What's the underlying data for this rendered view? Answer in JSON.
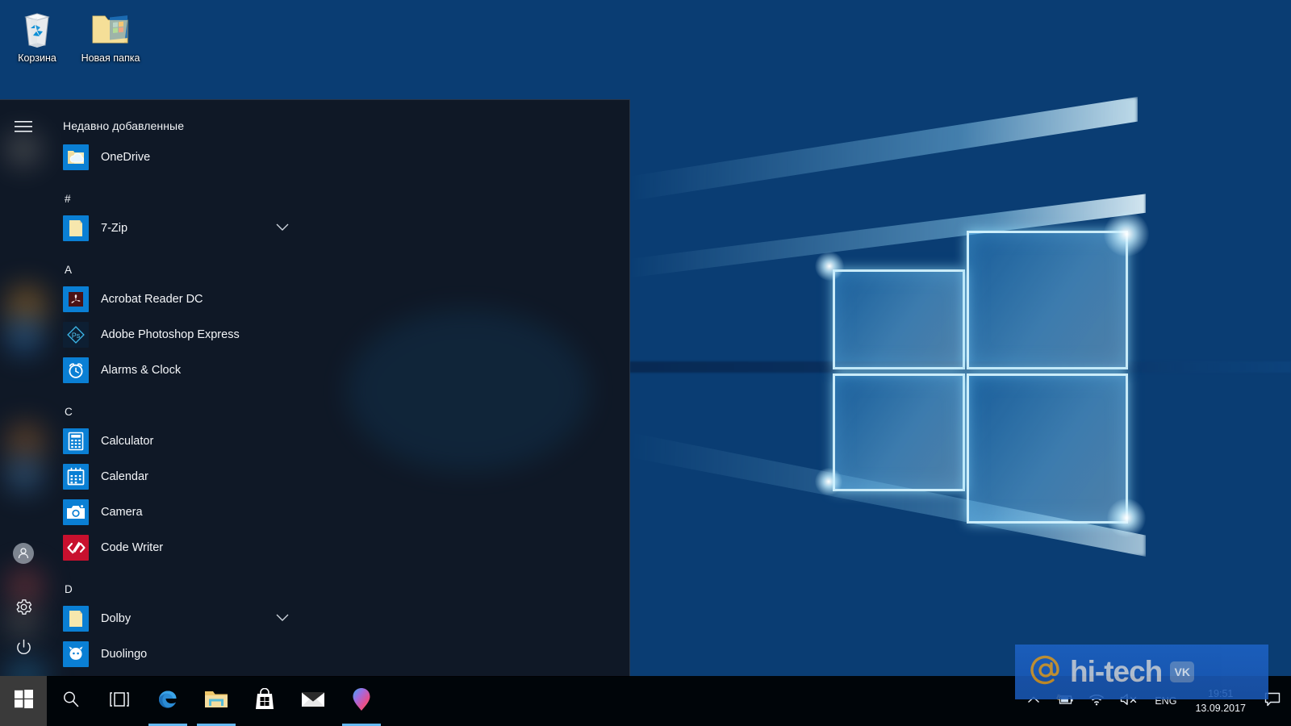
{
  "desktop": {
    "icons": [
      {
        "label": "Корзина",
        "icon": "recycle-bin-icon"
      },
      {
        "label": "Новая папка",
        "icon": "folder-icon"
      }
    ]
  },
  "start_menu": {
    "rail": {
      "hamburger": "hamburger-icon",
      "user": "user-account-icon",
      "settings": "gear-icon",
      "power": "power-icon"
    },
    "recent_header": "Недавно добавленные",
    "recent_apps": [
      {
        "label": "OneDrive",
        "icon": "onedrive-icon",
        "tile": "#0a7fd4",
        "expandable": false
      }
    ],
    "groups": [
      {
        "letter": "#",
        "apps": [
          {
            "label": "7-Zip",
            "icon": "folder-tile-icon",
            "tile": "#0a7fd4",
            "expandable": true
          }
        ]
      },
      {
        "letter": "A",
        "apps": [
          {
            "label": "Acrobat Reader DC",
            "icon": "acrobat-icon",
            "tile": "#0a7fd4",
            "expandable": false
          },
          {
            "label": "Adobe Photoshop Express",
            "icon": "photoshop-express-icon",
            "tile": "#10243f",
            "expandable": false
          },
          {
            "label": "Alarms & Clock",
            "icon": "alarm-clock-icon",
            "tile": "#0a7fd4",
            "expandable": false
          }
        ]
      },
      {
        "letter": "C",
        "apps": [
          {
            "label": "Calculator",
            "icon": "calculator-icon",
            "tile": "#0a7fd4",
            "expandable": false
          },
          {
            "label": "Calendar",
            "icon": "calendar-icon",
            "tile": "#0a7fd4",
            "expandable": false
          },
          {
            "label": "Camera",
            "icon": "camera-icon",
            "tile": "#0a7fd4",
            "expandable": false
          },
          {
            "label": "Code Writer",
            "icon": "code-writer-icon",
            "tile": "#c8102e",
            "expandable": false
          }
        ]
      },
      {
        "letter": "D",
        "apps": [
          {
            "label": "Dolby",
            "icon": "folder-tile-icon",
            "tile": "#0a7fd4",
            "expandable": true
          },
          {
            "label": "Duolingo",
            "icon": "duolingo-icon",
            "tile": "#0a7fd4",
            "expandable": false
          }
        ]
      }
    ]
  },
  "taskbar": {
    "start_button": "windows-logo-icon",
    "buttons": [
      {
        "name": "search-icon",
        "label": "Search",
        "active": false
      },
      {
        "name": "task-view-icon",
        "label": "Task View",
        "active": false
      },
      {
        "name": "edge-icon",
        "label": "Microsoft Edge",
        "active": true
      },
      {
        "name": "file-explorer-icon",
        "label": "File Explorer",
        "active": true
      },
      {
        "name": "microsoft-store-icon",
        "label": "Microsoft Store",
        "active": false
      },
      {
        "name": "mail-icon",
        "label": "Mail",
        "active": false
      },
      {
        "name": "paint3d-icon",
        "label": "Paint 3D",
        "active": true
      }
    ],
    "tray": {
      "show_hidden": "chevron-up-icon",
      "battery": "battery-charging-icon",
      "network": "wifi-icon",
      "volume": "speaker-muted-icon",
      "language": "ENG",
      "time": "19:51",
      "date": "13.09.2017",
      "action_center": "action-center-icon"
    }
  },
  "watermark": {
    "at_symbol": "@",
    "text": "hi-tech",
    "vk_badge": "VK"
  },
  "colors": {
    "accent": "#0a7fd4",
    "taskbar": "#000000",
    "menu_bg": "#101620",
    "indicator": "#63b8f0"
  }
}
